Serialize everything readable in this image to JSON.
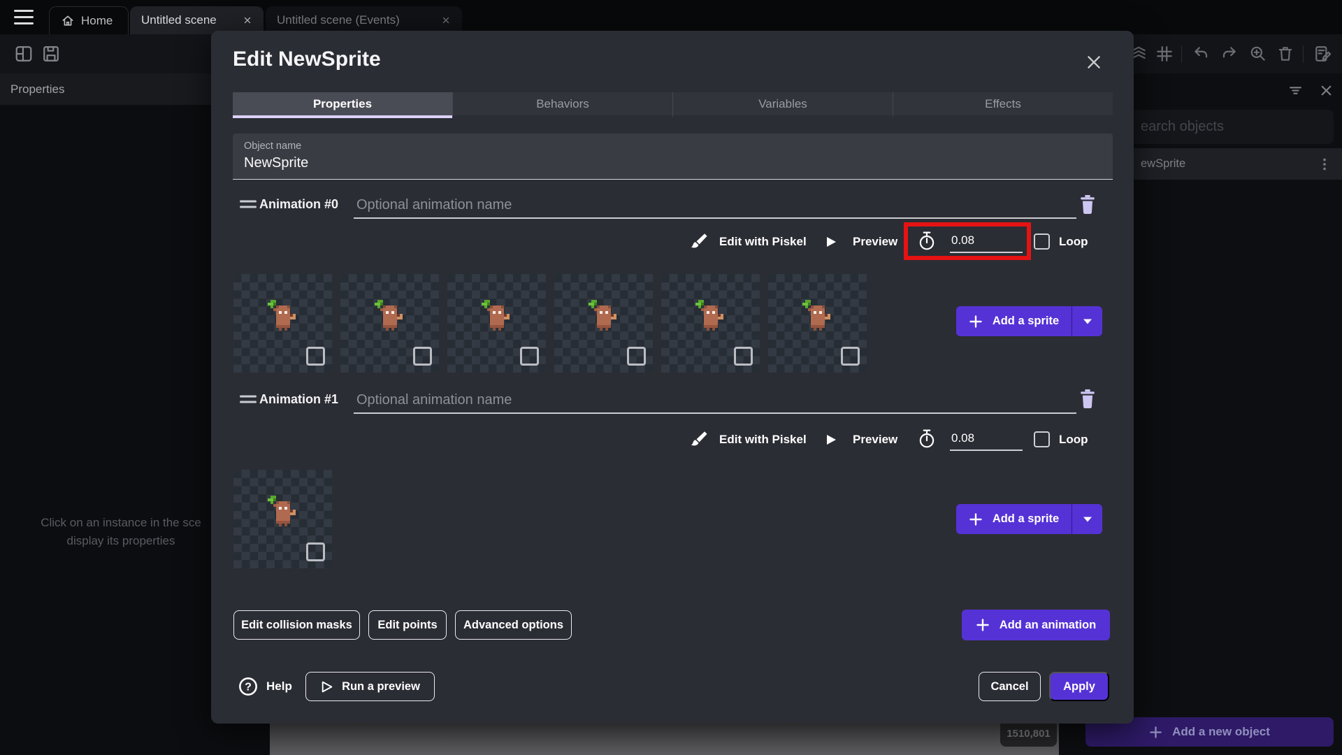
{
  "chrome": {
    "tabs": {
      "home": "Home",
      "scene": "Untitled scene",
      "events": "Untitled scene (Events)"
    }
  },
  "left_panel": {
    "header": "Properties",
    "empty_line1": "Click on an instance in the sce",
    "empty_line2": "display its properties"
  },
  "right_panel": {
    "search_placeholder": "earch objects",
    "object_name": "ewSprite",
    "add_object": "Add a new object"
  },
  "canvas": {
    "coords": "1510,801"
  },
  "dialog": {
    "title": "Edit NewSprite",
    "tabs": [
      "Properties",
      "Behaviors",
      "Variables",
      "Effects"
    ],
    "object_name": {
      "label": "Object name",
      "value": "NewSprite"
    },
    "animations": [
      {
        "title": "Animation #0",
        "placeholder": "Optional animation name",
        "edit": "Edit with Piskel",
        "preview": "Preview",
        "frame_time": "0.08",
        "loop": "Loop",
        "add_sprite": "Add a sprite",
        "frame_count": 6
      },
      {
        "title": "Animation #1",
        "placeholder": "Optional animation name",
        "edit": "Edit with Piskel",
        "preview": "Preview",
        "frame_time": "0.08",
        "loop": "Loop",
        "add_sprite": "Add a sprite",
        "frame_count": 1
      }
    ],
    "actions": {
      "collision": "Edit collision masks",
      "points": "Edit points",
      "advanced": "Advanced options",
      "add_animation": "Add an animation",
      "help": "Help",
      "run_preview": "Run a preview",
      "cancel": "Cancel",
      "apply": "Apply"
    },
    "colors": {
      "accent": "#5532D6",
      "highlight_red": "#E51313",
      "tab_underline": "#DCD1F9",
      "trash_icon": "#CDC6F2"
    }
  }
}
